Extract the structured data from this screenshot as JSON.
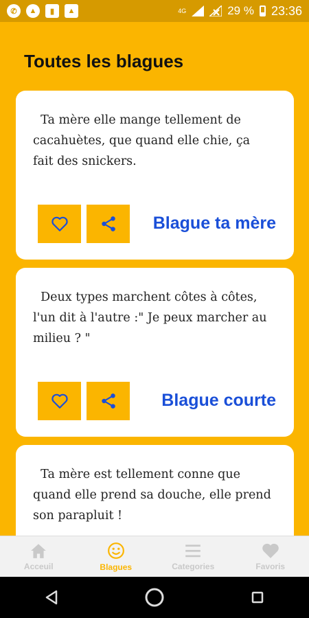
{
  "statusbar": {
    "icons": [
      "whatsapp-icon",
      "signal-app-icon",
      "twitch-icon",
      "image-icon"
    ],
    "network": "4G",
    "battery": "29 %",
    "time": "23:36"
  },
  "page": {
    "title": "Toutes les blagues"
  },
  "jokes": [
    {
      "text": "  Ta mère elle mange tellement de cacahuètes, que quand elle chie, ça fait des snickers.",
      "category": "Blague ta mère"
    },
    {
      "text": "  Deux types marchent côtes à côtes, l'un dit à l'autre :\" Je peux marcher au milieu ? \"",
      "category": "Blague courte"
    },
    {
      "text": "  Ta mère est tellement conne que quand elle prend sa douche, elle prend son parapluit !"
    }
  ],
  "bottom_nav": [
    {
      "label": "Acceuil",
      "icon": "home-icon",
      "active": false
    },
    {
      "label": "Blagues",
      "icon": "smiley-icon",
      "active": true
    },
    {
      "label": "Categories",
      "icon": "menu-icon",
      "active": false
    },
    {
      "label": "Favoris",
      "icon": "heart-icon",
      "active": false
    }
  ],
  "colors": {
    "background": "#fbb500",
    "category_text": "#1a4fd8",
    "inactive_nav": "#c9c9c9"
  }
}
